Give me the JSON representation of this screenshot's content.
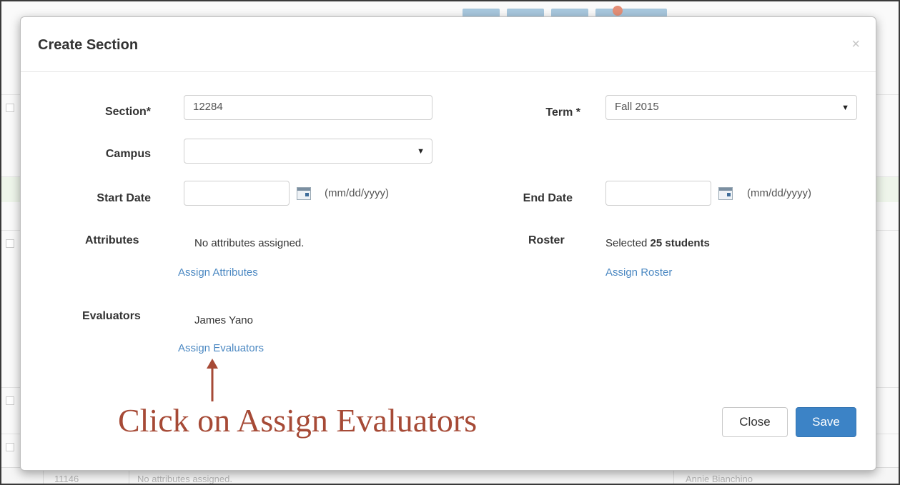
{
  "background": {
    "row_id": "11146",
    "row_attributes": "No attributes assigned.",
    "row_evaluator": "Annie Bianchino"
  },
  "modal": {
    "title": "Create Section",
    "close_icon": "×"
  },
  "form": {
    "section": {
      "label": "Section*",
      "value": "12284"
    },
    "term": {
      "label": "Term *",
      "value": "Fall 2015"
    },
    "campus": {
      "label": "Campus",
      "value": ""
    },
    "start_date": {
      "label": "Start Date",
      "value": "",
      "hint": "(mm/dd/yyyy)"
    },
    "end_date": {
      "label": "End Date",
      "value": "",
      "hint": "(mm/dd/yyyy)"
    },
    "attributes": {
      "label": "Attributes",
      "text": "No attributes assigned.",
      "link": "Assign Attributes"
    },
    "roster": {
      "label": "Roster",
      "text_prefix": "Selected",
      "text_bold": "25 students",
      "link": "Assign Roster"
    },
    "evaluators": {
      "label": "Evaluators",
      "text": "James Yano",
      "link": "Assign Evaluators"
    }
  },
  "annotation": {
    "text": "Click on Assign Evaluators",
    "color": "#a64a36"
  },
  "buttons": {
    "close": "Close",
    "save": "Save"
  },
  "colors": {
    "link": "#4b88c2",
    "primary": "#3c83c6"
  }
}
